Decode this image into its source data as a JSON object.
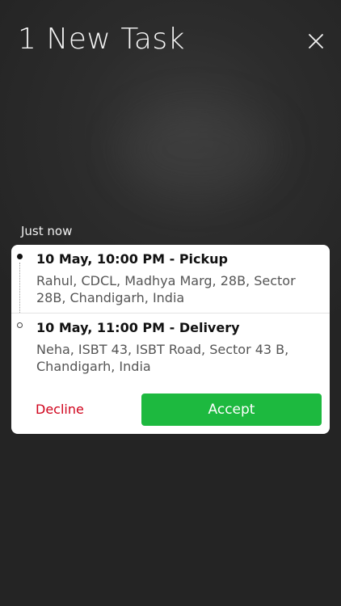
{
  "header": {
    "title": "1 New Task",
    "close_icon": "close-icon"
  },
  "timestamp": "Just now",
  "task": {
    "stops": [
      {
        "heading": "10 May, 10:00 PM - Pickup",
        "address": "Rahul, CDCL, Madhya Marg, 28B, Sector 28B, Chandigarh, India",
        "marker": "filled-dot"
      },
      {
        "heading": "10 May, 11:00 PM - Delivery",
        "address": "Neha, ISBT 43, ISBT Road, Sector 43 B, Chandigarh, India",
        "marker": "hollow-dot"
      }
    ],
    "decline_label": "Decline",
    "accept_label": "Accept"
  },
  "colors": {
    "accept": "#1db93f",
    "decline": "#d0021b",
    "background": "#2c2c2c"
  }
}
